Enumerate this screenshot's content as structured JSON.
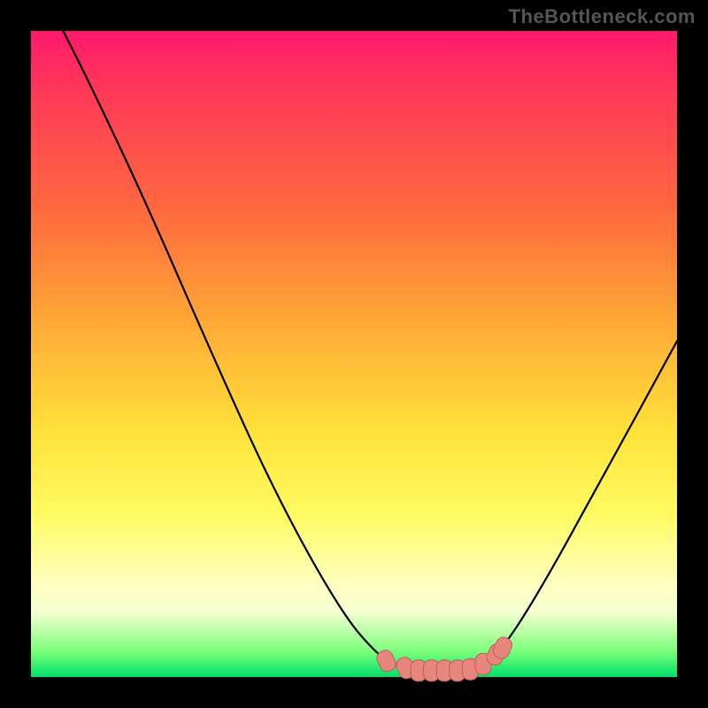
{
  "watermark": "TheBottleneck.com",
  "colors": {
    "frame_bg": "#000000",
    "curve": "#000000",
    "marker_fill": "#e8867e",
    "marker_stroke": "#b86058",
    "gradient_stops": [
      "#ff1a6b",
      "#ff3b57",
      "#ff6a3e",
      "#ffa836",
      "#ffe23a",
      "#fffb63",
      "#ffffc4",
      "#f4ffd0",
      "#7cff7a",
      "#00e06b"
    ]
  },
  "chart_data": {
    "type": "line",
    "title": "",
    "xlabel": "",
    "ylabel": "",
    "xlim": [
      0,
      100
    ],
    "ylim": [
      0,
      100
    ],
    "curve": [
      {
        "x": 5,
        "y": 100
      },
      {
        "x": 10,
        "y": 90
      },
      {
        "x": 18,
        "y": 73
      },
      {
        "x": 28,
        "y": 50
      },
      {
        "x": 38,
        "y": 28
      },
      {
        "x": 48,
        "y": 10
      },
      {
        "x": 54,
        "y": 3
      },
      {
        "x": 58,
        "y": 1
      },
      {
        "x": 63,
        "y": 1
      },
      {
        "x": 68,
        "y": 1
      },
      {
        "x": 72,
        "y": 3
      },
      {
        "x": 78,
        "y": 12
      },
      {
        "x": 88,
        "y": 30
      },
      {
        "x": 100,
        "y": 52
      }
    ],
    "markers": [
      {
        "x": 55,
        "y": 2.5
      },
      {
        "x": 58,
        "y": 1.4
      },
      {
        "x": 60,
        "y": 1.0
      },
      {
        "x": 62,
        "y": 1.0
      },
      {
        "x": 64,
        "y": 1.0
      },
      {
        "x": 66,
        "y": 1.0
      },
      {
        "x": 68,
        "y": 1.2
      },
      {
        "x": 70,
        "y": 2.0
      },
      {
        "x": 72,
        "y": 3.5
      },
      {
        "x": 73,
        "y": 4.5
      }
    ]
  }
}
